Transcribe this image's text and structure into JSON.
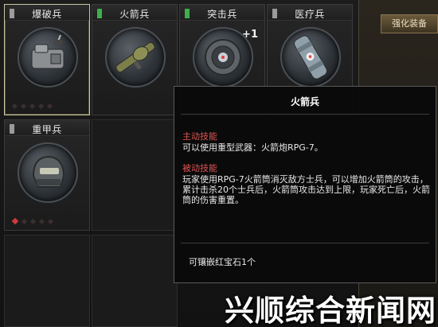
{
  "slots": [
    {
      "name": "爆破兵",
      "marker_color": "#9b9b9b",
      "gems": [
        false,
        false,
        false,
        false,
        false
      ],
      "icon": "explosive-pack-icon",
      "selected": true
    },
    {
      "name": "火箭兵",
      "marker_color": "#3db04b",
      "gems": [],
      "icon": "rocket-launcher-icon",
      "selected": false
    },
    {
      "name": "突击兵",
      "marker_color": "#3db04b",
      "gems": [],
      "icon": "assault-scope-icon",
      "badge": "+1",
      "selected": false
    },
    {
      "name": "医疗兵",
      "marker_color": "#9b9b9b",
      "gems": [],
      "icon": "medical-canister-icon",
      "selected": false
    },
    {
      "name": "重甲兵",
      "marker_color": "#9b9b9b",
      "gems": [
        true,
        false,
        false,
        false,
        false
      ],
      "icon": "heavy-armor-helmet-icon",
      "selected": false
    }
  ],
  "right_panel": {
    "tab_label": "强化装备"
  },
  "tooltip": {
    "title": "火箭兵",
    "active_heading": "主动技能",
    "active_body": "可以使用重型武器：火箭炮RPG-7。",
    "passive_heading": "被动技能",
    "passive_body": "玩家使用RPG-7火箭筒消灭敌方士兵，可以增加火箭筒的攻击，累计击杀20个士兵后，火箭筒攻击达到上限，玩家死亡后，火箭筒的伤害重置。",
    "footer": "可镶嵌红宝石1个"
  },
  "watermark": "兴顺综合新闻网",
  "colors": {
    "gem_active": "#d03a3a",
    "heading_red": "#e25454",
    "selected_border": "#c9c6a0"
  }
}
